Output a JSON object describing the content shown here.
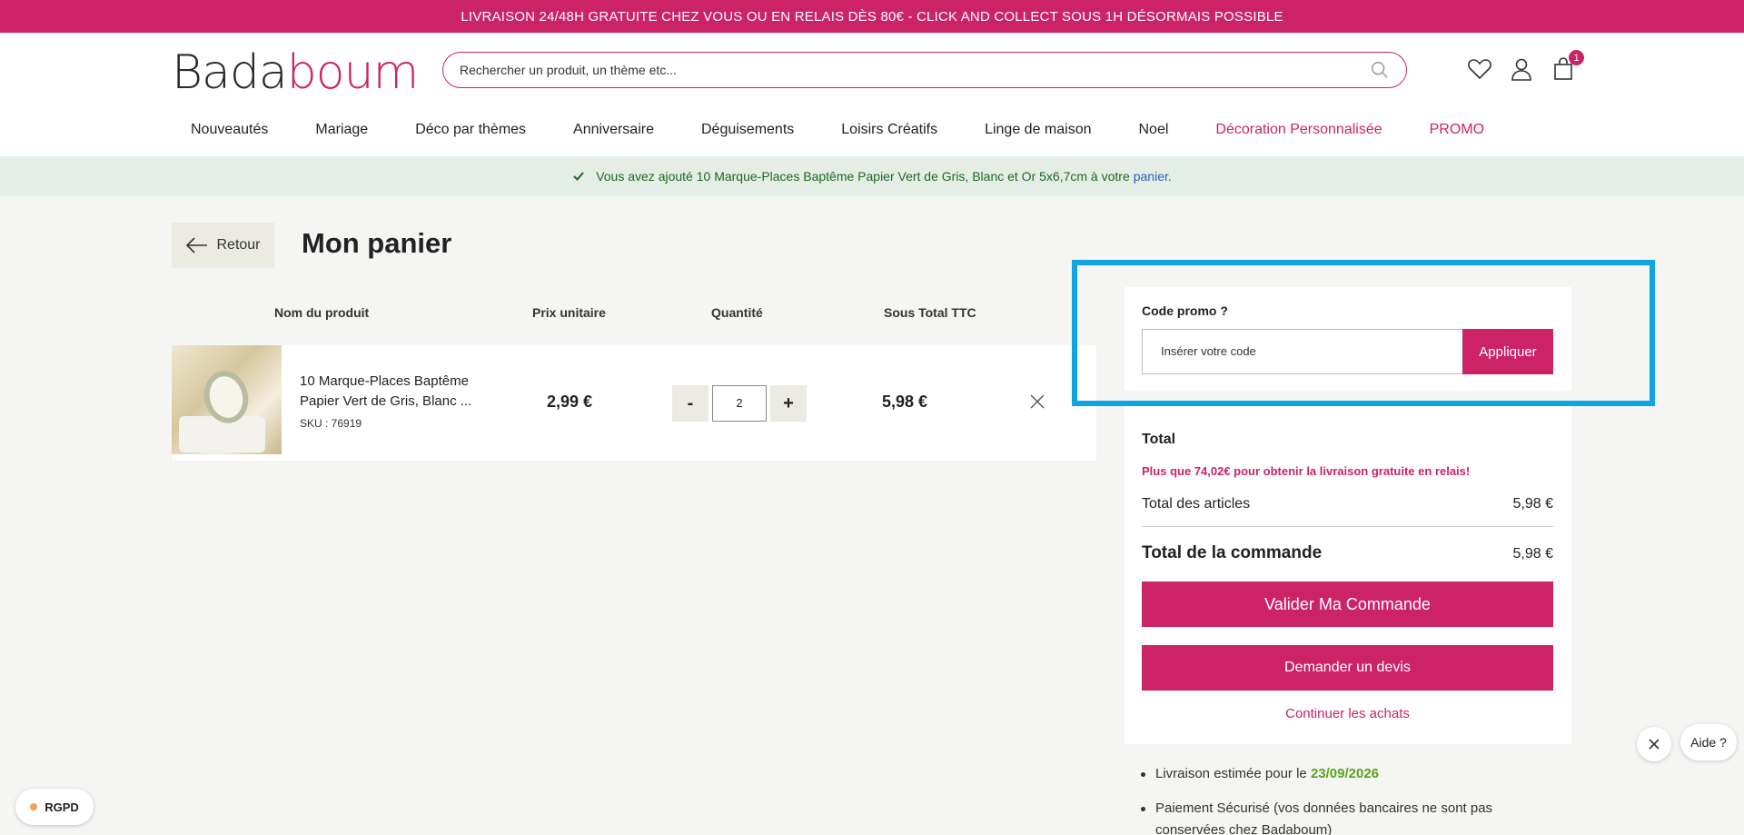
{
  "announcement": "LIVRAISON 24/48H GRATUITE CHEZ VOUS OU EN RELAIS DÈS 80€ - CLICK AND COLLECT SOUS 1H DÉSORMAIS POSSIBLE",
  "logo": {
    "part1": "Bada",
    "part2": "boum"
  },
  "search": {
    "placeholder": "Rechercher un produit, un thème etc..."
  },
  "header_icons": {
    "wishlist": "heart-icon",
    "account": "user-icon",
    "cart": "bag-icon",
    "cart_count": "1"
  },
  "nav": [
    {
      "label": "Nouveautés"
    },
    {
      "label": "Mariage"
    },
    {
      "label": "Déco par thèmes"
    },
    {
      "label": "Anniversaire"
    },
    {
      "label": "Déguisements"
    },
    {
      "label": "Loisirs Créatifs"
    },
    {
      "label": "Linge de maison"
    },
    {
      "label": "Noel"
    },
    {
      "label": "Décoration Personnalisée"
    },
    {
      "label": "PROMO"
    }
  ],
  "notice": {
    "text": "Vous avez ajouté 10 Marque-Places Baptême Papier Vert de Gris, Blanc et Or 5x6,7cm à votre",
    "link": "panier."
  },
  "back_label": "Retour",
  "page_title": "Mon panier",
  "table_headers": {
    "product": "Nom du produit",
    "unit_price": "Prix unitaire",
    "quantity": "Quantité",
    "subtotal": "Sous Total TTC"
  },
  "cart_item": {
    "name": "10 Marque-Places Baptême Papier Vert de Gris, Blanc ...",
    "sku": "SKU : 76919",
    "unit_price": "2,99 €",
    "quantity": "2",
    "minus": "-",
    "plus": "+",
    "subtotal": "5,98 €"
  },
  "promo": {
    "label": "Code promo ?",
    "placeholder": "Insérer votre code",
    "button": "Appliquer"
  },
  "summary": {
    "title": "Total",
    "free_shipping": "Plus que 74,02€ pour obtenir la livraison gratuite en relais!",
    "articles_label": "Total des articles",
    "articles_value": "5,98 €",
    "order_label": "Total de la commande",
    "order_value": "5,98 €",
    "validate_button": "Valider Ma Commande",
    "quote_button": "Demander un devis",
    "continue_link": "Continuer les achats"
  },
  "info": {
    "delivery_prefix": "Livraison estimée pour le",
    "delivery_date": "23/09/2026",
    "payment": "Paiement Sécurisé (vos données bancaires ne sont pas conservées chez Badaboum)"
  },
  "rgpd_label": "RGPD",
  "help_label": "Aide ?",
  "colors": {
    "brand": "#cc2366",
    "highlight": "#11a4e2",
    "success": "#1a6b1e"
  }
}
